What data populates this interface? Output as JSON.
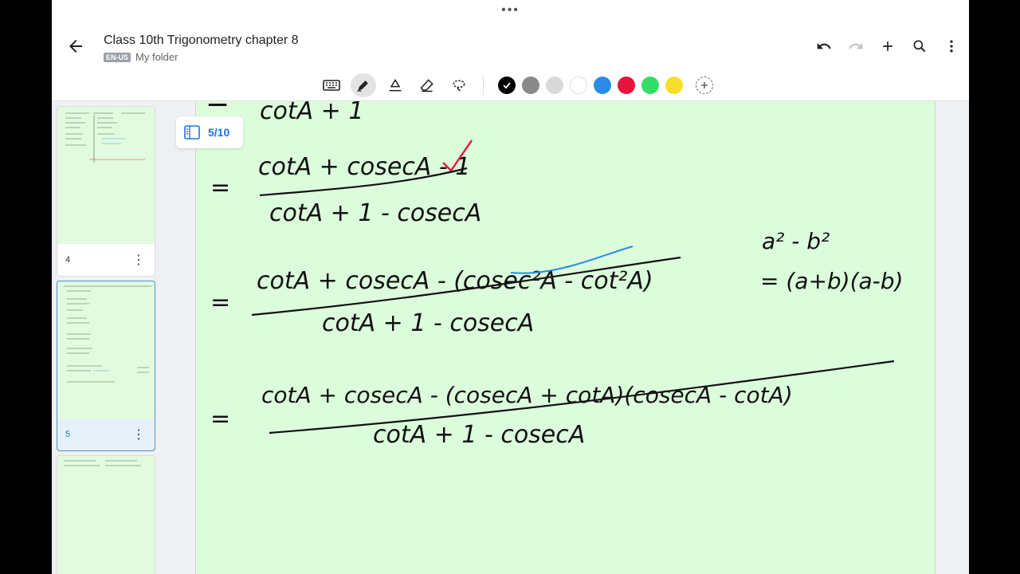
{
  "header": {
    "title": "Class 10th Trigonometry chapter 8",
    "language_badge": "EN-US",
    "folder": "My folder",
    "menu_dots": "•••"
  },
  "toolbar": {
    "tools": [
      "keyboard-icon",
      "pen-icon",
      "highlighter-icon",
      "eraser-icon",
      "lasso-icon"
    ],
    "active_tool": "pen-icon",
    "colors": [
      "#000000",
      "#8a8a8a",
      "#d9d9d9",
      "#ffffff",
      "#2a8be8",
      "#e8133a",
      "#33dd66",
      "#f8dd2a"
    ],
    "selected_color": "#000000"
  },
  "sidebar": {
    "pages": [
      {
        "number": "4"
      },
      {
        "number": "5"
      },
      {
        "number": ""
      }
    ],
    "active_page": "5"
  },
  "canvas": {
    "page_indicator": "5/10",
    "lines": [
      {
        "lhs": "=",
        "numerator": "cotA + 1",
        "denominator": ""
      },
      {
        "lhs": "=",
        "numerator": "cotA + cosecA - 1",
        "denominator": "cotA + 1 - cosecA"
      },
      {
        "lhs": "=",
        "numerator": "cotA + cosecA - (cosec²A - cot²A)",
        "denominator": "cotA + 1 - cosecA"
      },
      {
        "lhs": "=",
        "numerator": "cotA + cosecA - (cosecA + cotA)(cosecA - cotA)",
        "denominator": "cotA + 1 - cosecA"
      }
    ],
    "side_note": [
      "a² - b²",
      "= (a+b)(a-b)"
    ],
    "page_bg": "#dcfddc"
  }
}
